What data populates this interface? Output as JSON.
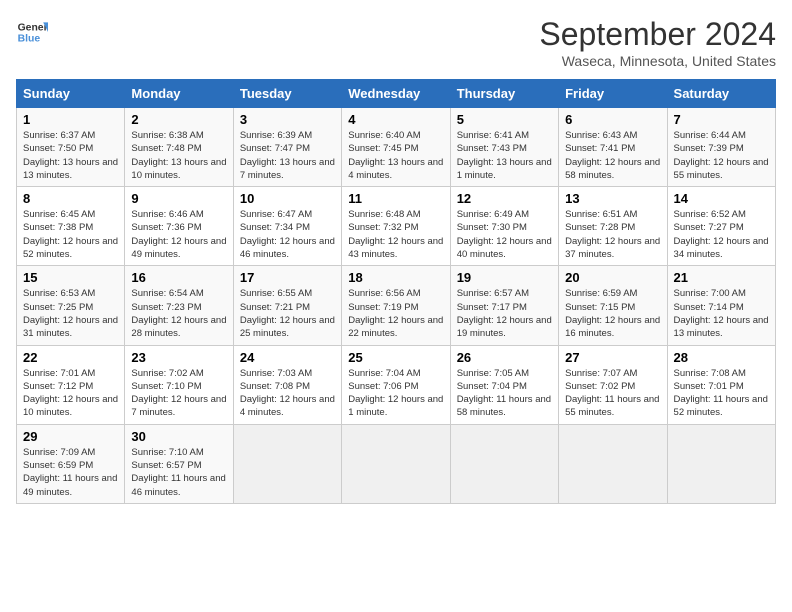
{
  "header": {
    "logo_line1": "General",
    "logo_line2": "Blue",
    "month": "September 2024",
    "location": "Waseca, Minnesota, United States"
  },
  "columns": [
    "Sunday",
    "Monday",
    "Tuesday",
    "Wednesday",
    "Thursday",
    "Friday",
    "Saturday"
  ],
  "weeks": [
    [
      {
        "day": "1",
        "sunrise": "6:37 AM",
        "sunset": "7:50 PM",
        "daylight": "13 hours and 13 minutes."
      },
      {
        "day": "2",
        "sunrise": "6:38 AM",
        "sunset": "7:48 PM",
        "daylight": "13 hours and 10 minutes."
      },
      {
        "day": "3",
        "sunrise": "6:39 AM",
        "sunset": "7:47 PM",
        "daylight": "13 hours and 7 minutes."
      },
      {
        "day": "4",
        "sunrise": "6:40 AM",
        "sunset": "7:45 PM",
        "daylight": "13 hours and 4 minutes."
      },
      {
        "day": "5",
        "sunrise": "6:41 AM",
        "sunset": "7:43 PM",
        "daylight": "13 hours and 1 minute."
      },
      {
        "day": "6",
        "sunrise": "6:43 AM",
        "sunset": "7:41 PM",
        "daylight": "12 hours and 58 minutes."
      },
      {
        "day": "7",
        "sunrise": "6:44 AM",
        "sunset": "7:39 PM",
        "daylight": "12 hours and 55 minutes."
      }
    ],
    [
      {
        "day": "8",
        "sunrise": "6:45 AM",
        "sunset": "7:38 PM",
        "daylight": "12 hours and 52 minutes."
      },
      {
        "day": "9",
        "sunrise": "6:46 AM",
        "sunset": "7:36 PM",
        "daylight": "12 hours and 49 minutes."
      },
      {
        "day": "10",
        "sunrise": "6:47 AM",
        "sunset": "7:34 PM",
        "daylight": "12 hours and 46 minutes."
      },
      {
        "day": "11",
        "sunrise": "6:48 AM",
        "sunset": "7:32 PM",
        "daylight": "12 hours and 43 minutes."
      },
      {
        "day": "12",
        "sunrise": "6:49 AM",
        "sunset": "7:30 PM",
        "daylight": "12 hours and 40 minutes."
      },
      {
        "day": "13",
        "sunrise": "6:51 AM",
        "sunset": "7:28 PM",
        "daylight": "12 hours and 37 minutes."
      },
      {
        "day": "14",
        "sunrise": "6:52 AM",
        "sunset": "7:27 PM",
        "daylight": "12 hours and 34 minutes."
      }
    ],
    [
      {
        "day": "15",
        "sunrise": "6:53 AM",
        "sunset": "7:25 PM",
        "daylight": "12 hours and 31 minutes."
      },
      {
        "day": "16",
        "sunrise": "6:54 AM",
        "sunset": "7:23 PM",
        "daylight": "12 hours and 28 minutes."
      },
      {
        "day": "17",
        "sunrise": "6:55 AM",
        "sunset": "7:21 PM",
        "daylight": "12 hours and 25 minutes."
      },
      {
        "day": "18",
        "sunrise": "6:56 AM",
        "sunset": "7:19 PM",
        "daylight": "12 hours and 22 minutes."
      },
      {
        "day": "19",
        "sunrise": "6:57 AM",
        "sunset": "7:17 PM",
        "daylight": "12 hours and 19 minutes."
      },
      {
        "day": "20",
        "sunrise": "6:59 AM",
        "sunset": "7:15 PM",
        "daylight": "12 hours and 16 minutes."
      },
      {
        "day": "21",
        "sunrise": "7:00 AM",
        "sunset": "7:14 PM",
        "daylight": "12 hours and 13 minutes."
      }
    ],
    [
      {
        "day": "22",
        "sunrise": "7:01 AM",
        "sunset": "7:12 PM",
        "daylight": "12 hours and 10 minutes."
      },
      {
        "day": "23",
        "sunrise": "7:02 AM",
        "sunset": "7:10 PM",
        "daylight": "12 hours and 7 minutes."
      },
      {
        "day": "24",
        "sunrise": "7:03 AM",
        "sunset": "7:08 PM",
        "daylight": "12 hours and 4 minutes."
      },
      {
        "day": "25",
        "sunrise": "7:04 AM",
        "sunset": "7:06 PM",
        "daylight": "12 hours and 1 minute."
      },
      {
        "day": "26",
        "sunrise": "7:05 AM",
        "sunset": "7:04 PM",
        "daylight": "11 hours and 58 minutes."
      },
      {
        "day": "27",
        "sunrise": "7:07 AM",
        "sunset": "7:02 PM",
        "daylight": "11 hours and 55 minutes."
      },
      {
        "day": "28",
        "sunrise": "7:08 AM",
        "sunset": "7:01 PM",
        "daylight": "11 hours and 52 minutes."
      }
    ],
    [
      {
        "day": "29",
        "sunrise": "7:09 AM",
        "sunset": "6:59 PM",
        "daylight": "11 hours and 49 minutes."
      },
      {
        "day": "30",
        "sunrise": "7:10 AM",
        "sunset": "6:57 PM",
        "daylight": "11 hours and 46 minutes."
      },
      null,
      null,
      null,
      null,
      null
    ]
  ]
}
